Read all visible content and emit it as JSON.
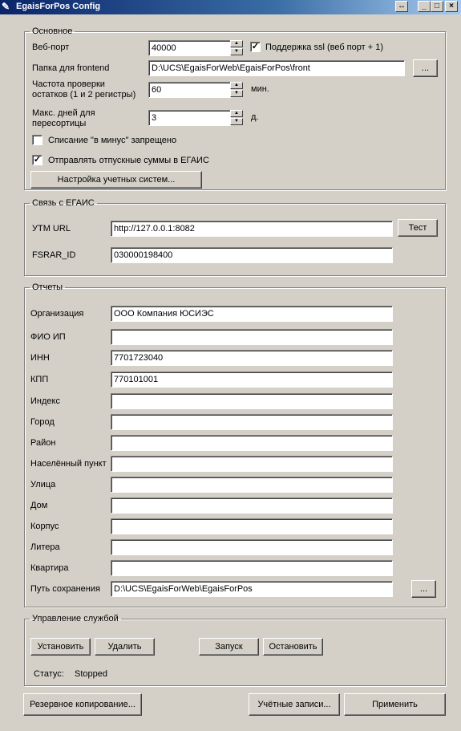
{
  "window": {
    "title": "EgaisForPos Config",
    "controls": {
      "resize": "↔",
      "minimize": "_",
      "maximize": "□",
      "close": "×"
    }
  },
  "main_group": {
    "legend": "Основное",
    "web_port_label": "Веб-порт",
    "web_port_value": "40000",
    "ssl_label": "Поддержка ssl (веб порт + 1)",
    "ssl_checked": true,
    "frontend_label": "Папка для frontend",
    "frontend_value": "D:\\UCS\\EgaisForWeb\\EgaisForPos\\front",
    "browse_label": "...",
    "check_freq_label_1": "Частота проверки",
    "check_freq_label_2": "остатков (1 и 2 регистры)",
    "check_freq_value": "60",
    "check_freq_unit": "мин.",
    "max_days_label_1": "Макс. дней для",
    "max_days_label_2": "пересортицы",
    "max_days_value": "3",
    "max_days_unit": "д.",
    "writeoff_label": "Списание \"в минус\" запрещено",
    "writeoff_checked": false,
    "send_sums_label": "Отправлять отпускные суммы в ЕГАИС",
    "send_sums_checked": true,
    "accounting_button": "Настройка учетных систем..."
  },
  "egais_group": {
    "legend": "Связь с ЕГАИС",
    "utm_label": "УТМ URL",
    "utm_value": "http://127.0.0.1:8082",
    "test_button": "Тест",
    "fsrar_label": "FSRAR_ID",
    "fsrar_value": "030000198400"
  },
  "reports_group": {
    "legend": "Отчеты",
    "fields": [
      {
        "label": "Организация",
        "value": "ООО Компания ЮСИЭС"
      },
      {
        "label": "ФИО ИП",
        "value": ""
      },
      {
        "label": "ИНН",
        "value": "7701723040"
      },
      {
        "label": "КПП",
        "value": "770101001"
      },
      {
        "label": "Индекс",
        "value": ""
      },
      {
        "label": "Город",
        "value": ""
      },
      {
        "label": "Район",
        "value": ""
      },
      {
        "label": "Населённый пункт",
        "value": ""
      },
      {
        "label": "Улица",
        "value": ""
      },
      {
        "label": "Дом",
        "value": ""
      },
      {
        "label": "Корпус",
        "value": ""
      },
      {
        "label": "Литера",
        "value": ""
      },
      {
        "label": "Квартира",
        "value": ""
      },
      {
        "label": "Путь сохранения",
        "value": "D:\\UCS\\EgaisForWeb\\EgaisForPos"
      }
    ],
    "browse_label": "..."
  },
  "service_group": {
    "legend": "Управление службой",
    "install_button": "Установить",
    "remove_button": "Удалить",
    "start_button": "Запуск",
    "stop_button": "Остановить",
    "status_label": "Статус:",
    "status_value": "Stopped"
  },
  "footer": {
    "backup_button": "Резервное копирование...",
    "accounts_button": "Учётные записи...",
    "apply_button": "Применить"
  }
}
